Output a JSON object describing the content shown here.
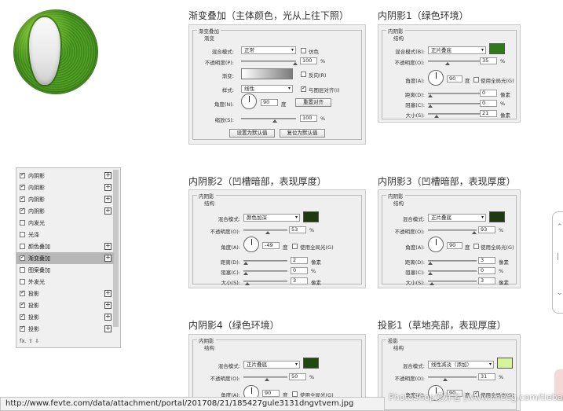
{
  "headings": {
    "gradient": "渐变叠加（主体颜色，光从上往下照）",
    "inner1": "内阴影1（绿色环境）",
    "inner2": "内阴影2（凹槽暗部，表现厚度）",
    "inner3": "内阴影3（凹槽暗部，表现厚度）",
    "inner4": "内阴影4（绿色环境）",
    "drop1": "投影1（草地亮部，表现厚度）"
  },
  "gradient_panel": {
    "group": "渐变叠加",
    "sub": "渐变",
    "blend_label": "混合模式:",
    "blend_value": "正常",
    "dither_label": "仿色",
    "opacity_label": "不透明度(P):",
    "opacity_value": "100",
    "opacity_unit": "%",
    "gradient_label": "渐变:",
    "reverse_label": "反向(R)",
    "style_label": "样式:",
    "style_value": "线性",
    "align_label": "与图层对齐(I)",
    "angle_label": "角度(N):",
    "angle_value": "90",
    "angle_unit": "度",
    "reset_align": "重置对齐",
    "scale_label": "缩放(S):",
    "scale_value": "100",
    "scale_unit": "%",
    "btn_default": "设置为默认值",
    "btn_reset": "复位为默认值"
  },
  "inner1_panel": {
    "group": "内阴影",
    "sub": "结构",
    "blend_label": "混合模式(B):",
    "blend_value": "正片叠底",
    "color": "#2e7a18",
    "opacity_label": "不透明度(O):",
    "opacity_value": "35",
    "opacity_unit": "%",
    "angle_label": "角度(A):",
    "angle_value": "90",
    "angle_unit": "度",
    "global_label": "使用全局光(G)",
    "distance_label": "距离(D):",
    "distance_value": "0",
    "distance_unit": "像素",
    "choke_label": "阻塞(C):",
    "choke_value": "0",
    "choke_unit": "%",
    "size_label": "大小(S):",
    "size_value": "21",
    "size_unit": "像素"
  },
  "inner2_panel": {
    "group": "内阴影",
    "sub": "结构",
    "blend_label": "混合模式:",
    "blend_value": "颜色加深",
    "color": "#1e3a0e",
    "opacity_label": "不透明度(O):",
    "opacity_value": "53",
    "opacity_unit": "%",
    "angle_label": "角度(A):",
    "angle_value": "-49",
    "angle_unit": "度",
    "global_label": "使用全局光(G)",
    "distance_label": "距离(D):",
    "distance_value": "2",
    "distance_unit": "像素",
    "choke_label": "阻塞(C):",
    "choke_value": "0",
    "choke_unit": "%",
    "size_label": "大小(S):",
    "size_value": "3",
    "size_unit": "像素"
  },
  "inner3_panel": {
    "group": "内阴影",
    "sub": "结构",
    "blend_label": "混合模式:",
    "blend_value": "正片叠底",
    "color": "#1e3a0e",
    "opacity_label": "不透明度(O):",
    "opacity_value": "93",
    "opacity_unit": "%",
    "angle_label": "角度(A):",
    "angle_value": "90",
    "angle_unit": "度",
    "global_label": "使用全局光(G)",
    "distance_label": "距离(D):",
    "distance_value": "3",
    "distance_unit": "像素",
    "choke_label": "阻塞(C):",
    "choke_value": "0",
    "choke_unit": "%",
    "size_label": "大小(S):",
    "size_value": "3",
    "size_unit": "像素"
  },
  "inner4_panel": {
    "group": "内阴影",
    "sub": "结构",
    "blend_label": "混合模式:",
    "blend_value": "正片叠底",
    "color": "#1e4a10",
    "opacity_label": "不透明度(O):",
    "opacity_value": "50",
    "opacity_unit": "%",
    "angle_label": "角度(A):",
    "angle_value": "90",
    "angle_unit": "度",
    "global_label": "使用全局光(G)"
  },
  "drop1_panel": {
    "group": "投影",
    "sub": "结构",
    "blend_label": "混合模式:",
    "blend_value": "线性减淡（添加）",
    "color": "#d6f59a",
    "opacity_label": "不透明度(O):",
    "opacity_value": "31",
    "opacity_unit": "%",
    "angle_label": "角度(A):",
    "angle_value": "90",
    "angle_unit": "度",
    "global_label": "使用全局光(G)"
  },
  "style_list": {
    "items": [
      {
        "label": "内阴影",
        "checked": true,
        "plus": true,
        "selected": false
      },
      {
        "label": "内阴影",
        "checked": true,
        "plus": true,
        "selected": false
      },
      {
        "label": "内阴影",
        "checked": true,
        "plus": true,
        "selected": false
      },
      {
        "label": "内阴影",
        "checked": true,
        "plus": true,
        "selected": false
      },
      {
        "label": "内发光",
        "checked": false,
        "plus": false,
        "selected": false
      },
      {
        "label": "光泽",
        "checked": false,
        "plus": false,
        "selected": false
      },
      {
        "label": "颜色叠加",
        "checked": false,
        "plus": true,
        "selected": false
      },
      {
        "label": "渐变叠加",
        "checked": true,
        "plus": true,
        "selected": true
      },
      {
        "label": "图案叠加",
        "checked": false,
        "plus": false,
        "selected": false
      },
      {
        "label": "外发光",
        "checked": false,
        "plus": false,
        "selected": false
      },
      {
        "label": "投影",
        "checked": true,
        "plus": true,
        "selected": false
      },
      {
        "label": "投影",
        "checked": true,
        "plus": true,
        "selected": false
      },
      {
        "label": "投影",
        "checked": true,
        "plus": true,
        "selected": false
      },
      {
        "label": "投影",
        "checked": true,
        "plus": true,
        "selected": false
      }
    ],
    "footer": "fx. ⇧ ⇩"
  },
  "status_url": "http://www.fevte.com/data/attachment/portal/201708/21/185427gule3131dngvtvem.jpg",
  "watermark": "PhotoShop爱好者 [www.lineeg.com/tieba/1703]"
}
